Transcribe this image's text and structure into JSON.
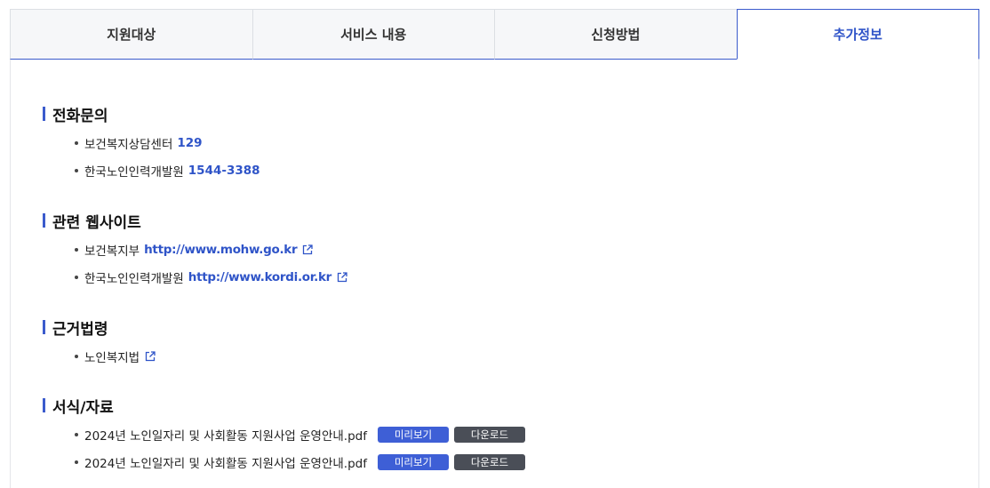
{
  "tabs": [
    {
      "label": "지원대상"
    },
    {
      "label": "서비스 내용"
    },
    {
      "label": "신청방법"
    },
    {
      "label": "추가정보"
    }
  ],
  "sections": {
    "phone": {
      "title": "전화문의",
      "items": [
        {
          "name": "보건복지상담센터",
          "value": "129"
        },
        {
          "name": "한국노인인력개발원",
          "value": "1544-3388"
        }
      ]
    },
    "websites": {
      "title": "관련 웹사이트",
      "items": [
        {
          "name": "보건복지부",
          "url": "http://www.mohw.go.kr"
        },
        {
          "name": "한국노인인력개발원",
          "url": "http://www.kordi.or.kr"
        }
      ]
    },
    "laws": {
      "title": "근거법령",
      "items": [
        {
          "name": "노인복지법"
        }
      ]
    },
    "forms": {
      "title": "서식/자료",
      "items": [
        {
          "name": "2024년 노인일자리 및 사회활동 지원사업 운영안내.pdf",
          "preview": "미리보기",
          "download": "다운로드"
        },
        {
          "name": "2024년 노인일자리 및 사회활동 지원사업 운영안내.pdf",
          "preview": "미리보기",
          "download": "다운로드"
        }
      ]
    }
  },
  "colors": {
    "accent": "#3b5bcc",
    "link": "#2f54c8",
    "download_btn": "#4a4e57"
  }
}
